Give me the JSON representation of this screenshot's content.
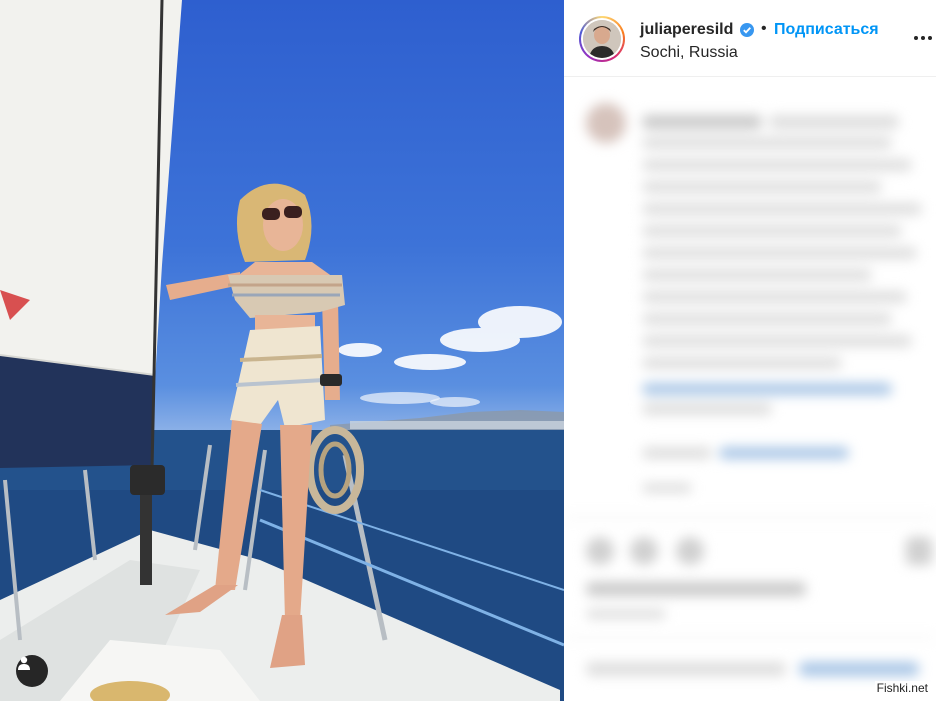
{
  "post": {
    "username": "juliaperesild",
    "separator": "•",
    "follow_label": "Подписаться",
    "location": "Sochi, Russia"
  },
  "icons": {
    "verified": "verified-badge-icon",
    "more": "more-options-icon",
    "tagged_user": "user-tag-icon"
  },
  "watermark": "Fishki.net",
  "colors": {
    "accent": "#0095f6",
    "text": "#262626",
    "verified": "#3897f0"
  }
}
